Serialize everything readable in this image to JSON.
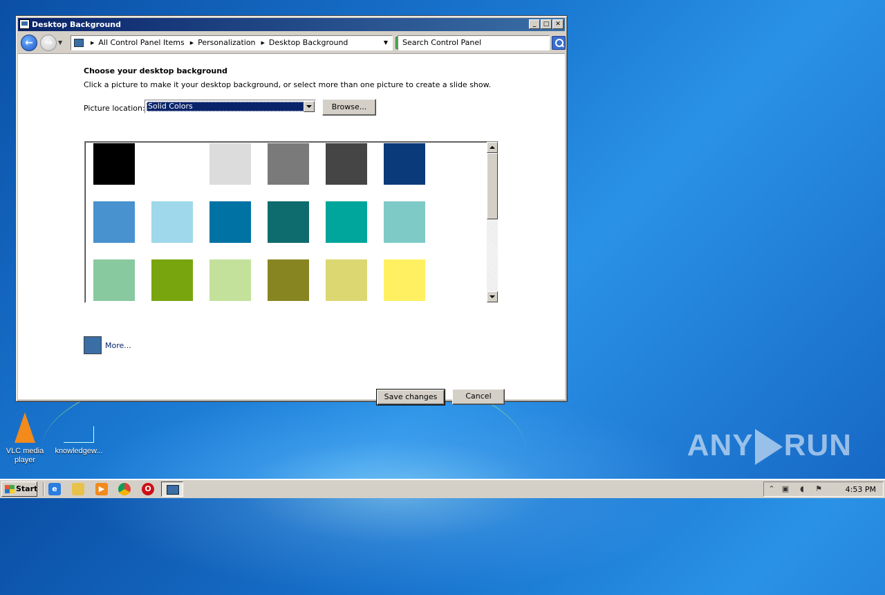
{
  "window": {
    "title": "Desktop Background",
    "controls": {
      "minimize": "_",
      "maximize": "□",
      "close": "✕"
    }
  },
  "addressbar": {
    "back_icon": "back-arrow-icon",
    "forward_icon": "forward-arrow-icon",
    "breadcrumb": [
      "All Control Panel Items",
      "Personalization",
      "Desktop Background"
    ],
    "search_placeholder": "Search Control Panel"
  },
  "content": {
    "heading": "Choose your desktop background",
    "description": "Click a picture to make it your desktop background, or select more than one picture to create a slide show.",
    "picture_location_label": "Picture location:",
    "picture_location_value": "Solid Colors",
    "browse_label": "Browse...",
    "swatches": [
      "#000000",
      "#ffffff",
      "#dcdcdc",
      "#7a7a7a",
      "#454545",
      "#0b3a7a",
      "#4892d0",
      "#9ed8ea",
      "#0072a3",
      "#0e6b6e",
      "#00a69c",
      "#7ecac6",
      "#88c99f",
      "#78a50d",
      "#c3e19b",
      "#878521",
      "#dcd771",
      "#fff062"
    ],
    "more_swatch_color": "#3a6ea5",
    "more_label": "More...",
    "save_label": "Save changes",
    "cancel_label": "Cancel"
  },
  "desktop": {
    "icons": [
      {
        "label": "VLC media player",
        "icon": "vlc-cone-icon"
      },
      {
        "label": "knowledgew...",
        "icon": "file-icon"
      }
    ],
    "watermark": "ANY RUN"
  },
  "taskbar": {
    "start_label": "Start",
    "quick_launch": [
      "internet-explorer-icon",
      "folder-icon",
      "media-player-icon",
      "chrome-icon",
      "opera-icon"
    ],
    "clock": "4:53 PM"
  }
}
